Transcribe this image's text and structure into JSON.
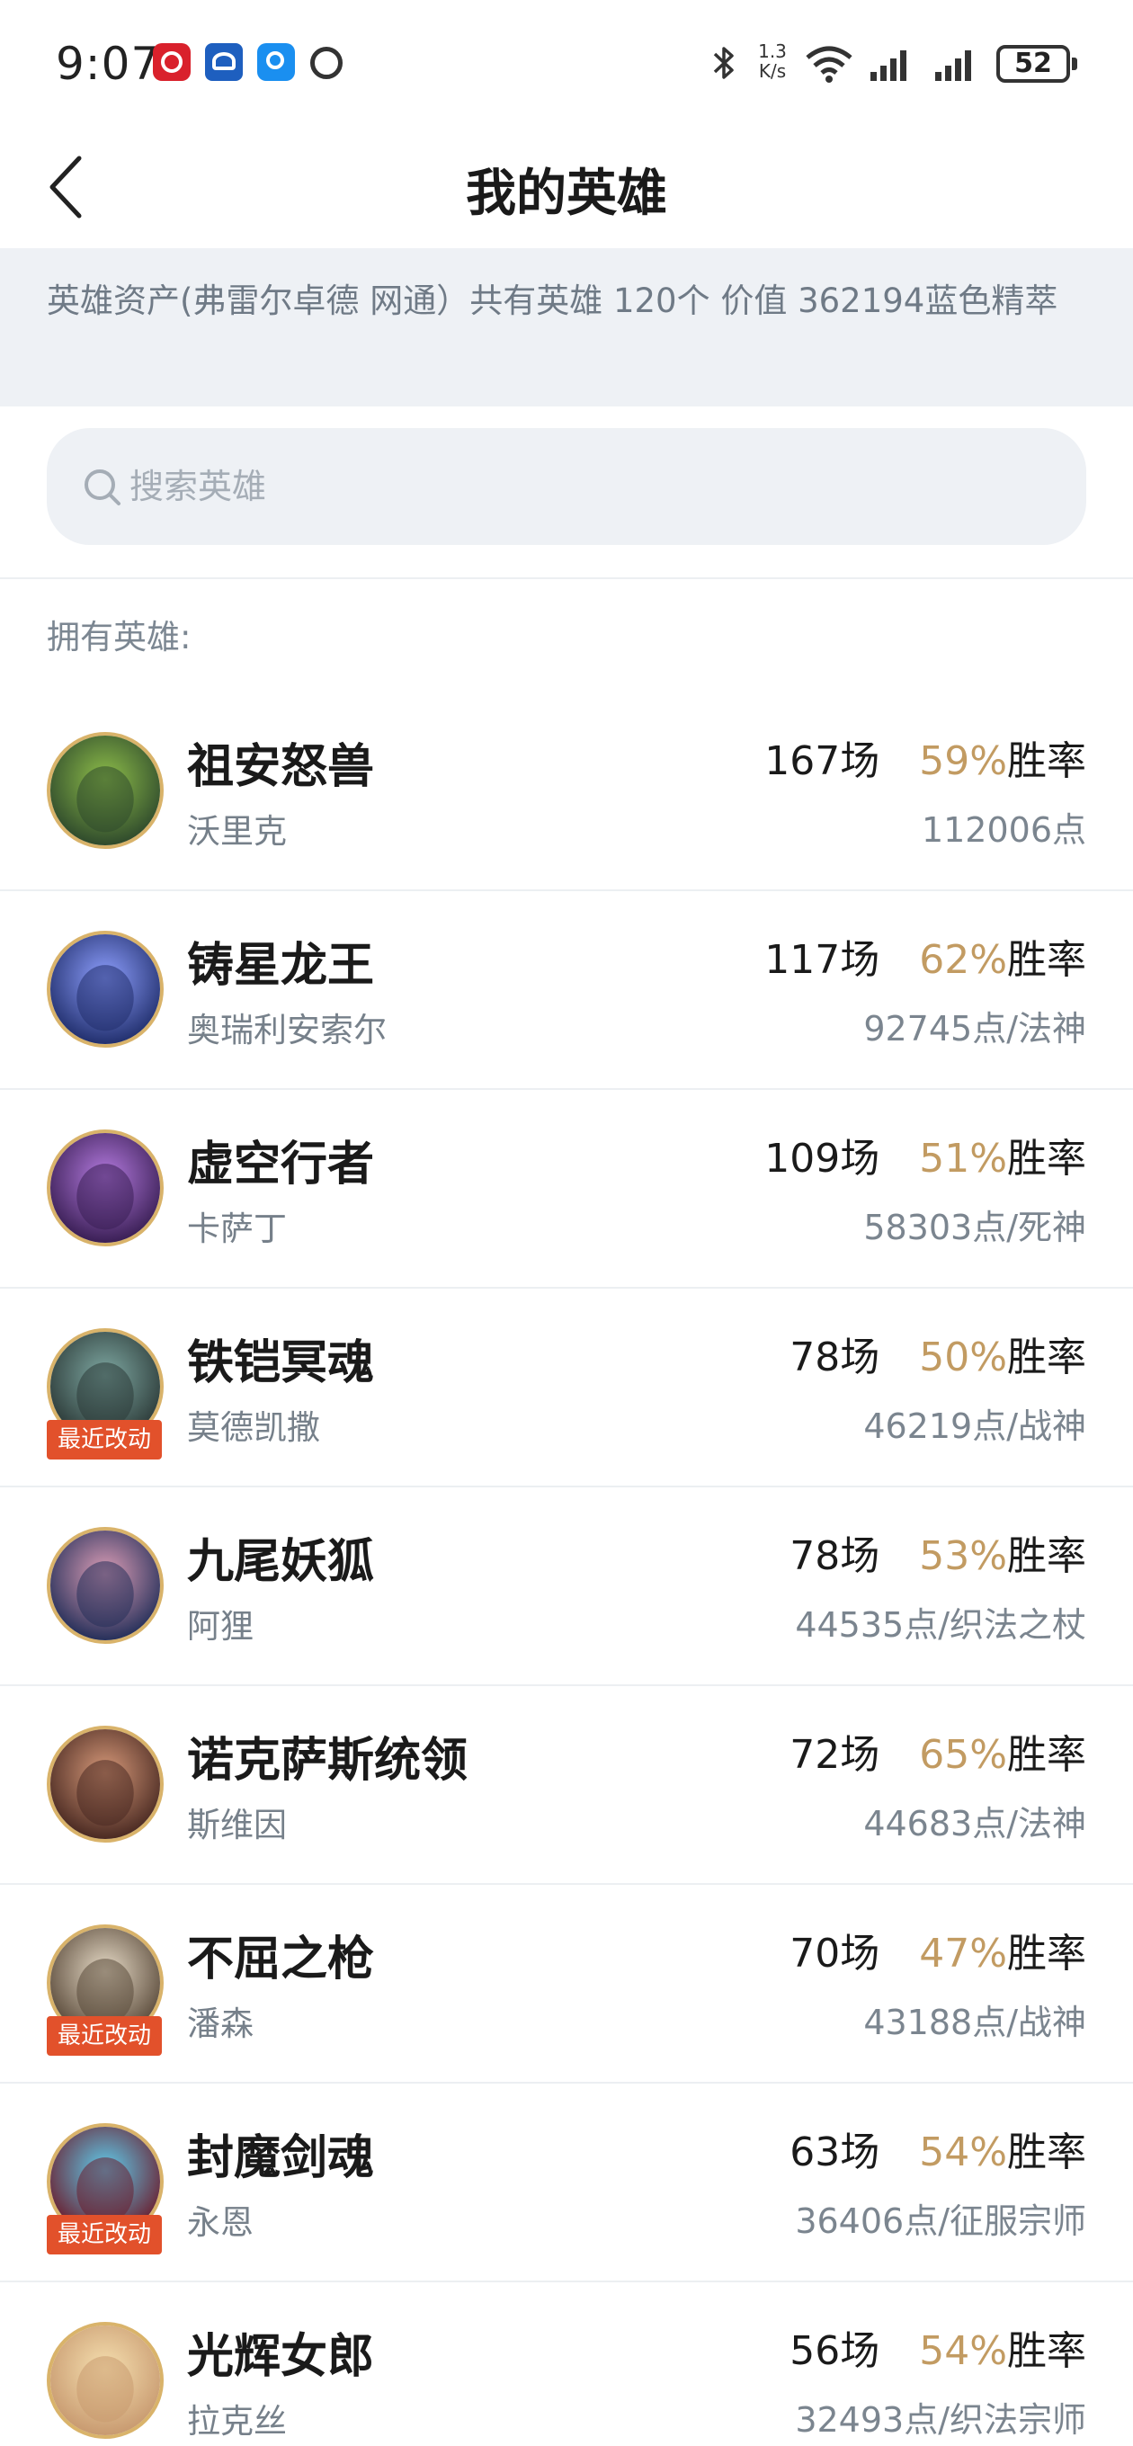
{
  "status_bar": {
    "time": "9:07",
    "net_speed_value": "1.3",
    "net_speed_unit": "K/s",
    "battery": "52"
  },
  "header": {
    "title": "我的英雄"
  },
  "banner": {
    "text": "英雄资产(弗雷尔卓德 网通）共有英雄 120个  价值 362194蓝色精萃"
  },
  "search": {
    "placeholder": "搜索英雄"
  },
  "section_label": "拥有英雄:",
  "heroes": [
    {
      "title": "祖安怒兽",
      "name": "沃里克",
      "games": "167场",
      "winrate": "59%",
      "winrate_suffix": "胜率",
      "points": "112006点",
      "badge": "",
      "avatar_color": "#2f4a2c",
      "avatar_accent": "#8fbf4a"
    },
    {
      "title": "铸星龙王",
      "name": "奥瑞利安索尔",
      "games": "117场",
      "winrate": "62%",
      "winrate_suffix": "胜率",
      "points": "92745点/法神",
      "badge": "",
      "avatar_color": "#22306e",
      "avatar_accent": "#8fa0ff"
    },
    {
      "title": "虚空行者",
      "name": "卡萨丁",
      "games": "109场",
      "winrate": "51%",
      "winrate_suffix": "胜率",
      "points": "58303点/死神",
      "badge": "",
      "avatar_color": "#3a1f55",
      "avatar_accent": "#b57be0"
    },
    {
      "title": "铁铠冥魂",
      "name": "莫德凯撒",
      "games": "78场",
      "winrate": "50%",
      "winrate_suffix": "胜率",
      "points": "46219点/战神",
      "badge": "最近改动",
      "avatar_color": "#2c3a38",
      "avatar_accent": "#7fa9a3"
    },
    {
      "title": "九尾妖狐",
      "name": "阿狸",
      "games": "78场",
      "winrate": "53%",
      "winrate_suffix": "胜率",
      "points": "44535点/织法之杖",
      "badge": "",
      "avatar_color": "#26305a",
      "avatar_accent": "#e0a0b8"
    },
    {
      "title": "诺克萨斯统领",
      "name": "斯维因",
      "games": "72场",
      "winrate": "65%",
      "winrate_suffix": "胜率",
      "points": "44683点/法神",
      "badge": "",
      "avatar_color": "#4a2a22",
      "avatar_accent": "#d89a7a"
    },
    {
      "title": "不屈之枪",
      "name": "潘森",
      "games": "70场",
      "winrate": "47%",
      "winrate_suffix": "胜率",
      "points": "43188点/战神",
      "badge": "最近改动",
      "avatar_color": "#5a4a3a",
      "avatar_accent": "#e8dcc8"
    },
    {
      "title": "封魔剑魂",
      "name": "永恩",
      "games": "63场",
      "winrate": "54%",
      "winrate_suffix": "胜率",
      "points": "36406点/征服宗师",
      "badge": "最近改动",
      "avatar_color": "#6a1f30",
      "avatar_accent": "#5fd0f0"
    },
    {
      "title": "光辉女郎",
      "name": "拉克丝",
      "games": "56场",
      "winrate": "54%",
      "winrate_suffix": "胜率",
      "points": "32493点/织法宗师",
      "badge": "",
      "avatar_color": "#c89a70",
      "avatar_accent": "#f6e0b0"
    }
  ]
}
